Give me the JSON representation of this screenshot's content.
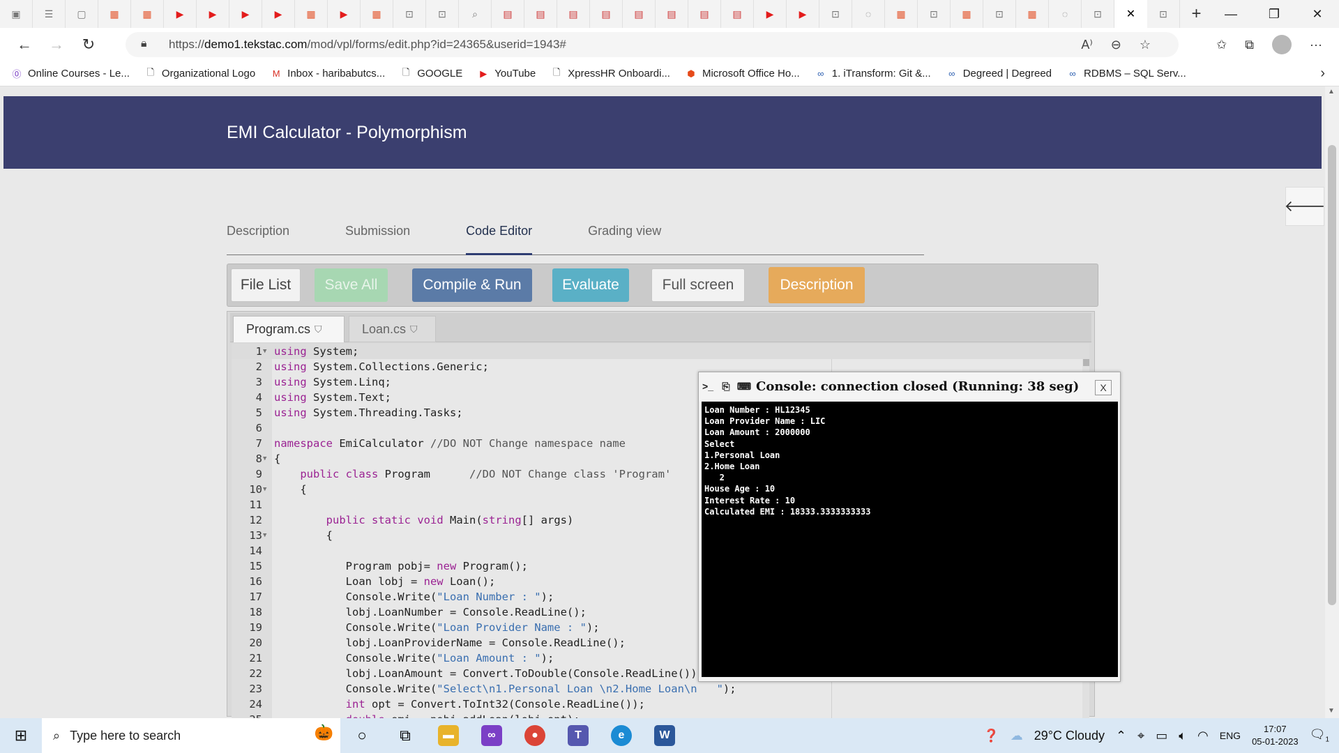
{
  "browser": {
    "url_prefix": "https://",
    "url_host": "demo1.tekstac.com",
    "url_path": "/mod/vpl/forms/edit.php?id=24365&userid=1943#",
    "bookmarks": [
      {
        "label": "Online Courses - Le...",
        "icon": "courses-icon"
      },
      {
        "label": "Organizational Logo",
        "icon": "page-icon"
      },
      {
        "label": "Inbox - haribabutcs...",
        "icon": "gmail-icon"
      },
      {
        "label": "GOOGLE",
        "icon": "page-icon"
      },
      {
        "label": "YouTube",
        "icon": "youtube-icon"
      },
      {
        "label": "XpressHR Onboardi...",
        "icon": "page-icon"
      },
      {
        "label": "Microsoft Office Ho...",
        "icon": "office-icon"
      },
      {
        "label": "1. iTransform: Git &...",
        "icon": "degreed-icon"
      },
      {
        "label": "Degreed | Degreed",
        "icon": "degreed-icon"
      },
      {
        "label": "RDBMS – SQL Serv...",
        "icon": "degreed-icon"
      }
    ]
  },
  "page": {
    "title": "EMI Calculator - Polymorphism",
    "tabs": [
      "Description",
      "Submission",
      "Code Editor",
      "Grading view"
    ],
    "active_tab": "Code Editor"
  },
  "toolbar": {
    "file_list": "File List",
    "save_all": "Save All",
    "compile_run": "Compile & Run",
    "evaluate": "Evaluate",
    "full_screen": "Full screen",
    "description": "Description"
  },
  "editor": {
    "files": [
      "Program.cs",
      "Loan.cs"
    ],
    "active_file": "Program.cs",
    "lines": [
      {
        "n": "1",
        "fold": true,
        "html": "<span class='kw'>using</span> System;"
      },
      {
        "n": "2",
        "fold": false,
        "html": "<span class='kw'>using</span> System.Collections.Generic;"
      },
      {
        "n": "3",
        "fold": false,
        "html": "<span class='kw'>using</span> System.Linq;"
      },
      {
        "n": "4",
        "fold": false,
        "html": "<span class='kw'>using</span> System.Text;"
      },
      {
        "n": "5",
        "fold": false,
        "html": "<span class='kw'>using</span> System.Threading.Tasks;"
      },
      {
        "n": "6",
        "fold": false,
        "html": ""
      },
      {
        "n": "7",
        "fold": false,
        "html": "<span class='kw'>namespace</span> EmiCalculator <span class='cm'>//DO NOT Change namespace name</span>"
      },
      {
        "n": "8",
        "fold": true,
        "html": "{"
      },
      {
        "n": "9",
        "fold": false,
        "html": "    <span class='kw'>public</span> <span class='kw'>class</span> Program      <span class='cm'>//DO NOT Change class 'Program'</span>"
      },
      {
        "n": "10",
        "fold": true,
        "html": "    {"
      },
      {
        "n": "11",
        "fold": false,
        "html": ""
      },
      {
        "n": "12",
        "fold": false,
        "html": "        <span class='kw'>public</span> <span class='kw'>static</span> <span class='kw'>void</span> Main(<span class='kw'>string</span>[] args)"
      },
      {
        "n": "13",
        "fold": true,
        "html": "        {"
      },
      {
        "n": "14",
        "fold": false,
        "html": ""
      },
      {
        "n": "15",
        "fold": false,
        "html": "           Program pobj= <span class='kw'>new</span> Program();"
      },
      {
        "n": "16",
        "fold": false,
        "html": "           Loan lobj = <span class='kw'>new</span> Loan();"
      },
      {
        "n": "17",
        "fold": false,
        "html": "           Console.Write(<span class='st'>\"Loan Number : \"</span>);"
      },
      {
        "n": "18",
        "fold": false,
        "html": "           lobj.LoanNumber = Console.ReadLine();"
      },
      {
        "n": "19",
        "fold": false,
        "html": "           Console.Write(<span class='st'>\"Loan Provider Name : \"</span>);"
      },
      {
        "n": "20",
        "fold": false,
        "html": "           lobj.LoanProviderName = Console.ReadLine();"
      },
      {
        "n": "21",
        "fold": false,
        "html": "           Console.Write(<span class='st'>\"Loan Amount : \"</span>);"
      },
      {
        "n": "22",
        "fold": false,
        "html": "           lobj.LoanAmount = Convert.ToDouble(Console.ReadLine());"
      },
      {
        "n": "23",
        "fold": false,
        "html": "           Console.Write(<span class='st'>\"Select\\n1.Personal Loan \\n2.Home Loan\\n   \"</span>);"
      },
      {
        "n": "24",
        "fold": false,
        "html": "           <span class='kw'>int</span> opt = Convert.ToInt32(Console.ReadLine());"
      },
      {
        "n": "25",
        "fold": false,
        "html": "           <span class='kw'>double</span> emi = pobj.addLoan(lobj,opt);"
      }
    ]
  },
  "console": {
    "title": "Console: connection closed (Running: 38 seg)",
    "close_label": "X",
    "output": "Loan Number : HL12345\nLoan Provider Name : LIC\nLoan Amount : 2000000\nSelect\n1.Personal Loan\n2.Home Loan\n   2\nHouse Age : 10\nInterest Rate : 10\nCalculated EMI : 18333.3333333333"
  },
  "taskbar": {
    "search_placeholder": "Type here to search",
    "weather": "29°C  Cloudy",
    "language": "ENG",
    "time": "17:07",
    "date": "05-01-2023",
    "notification_count": "1"
  }
}
